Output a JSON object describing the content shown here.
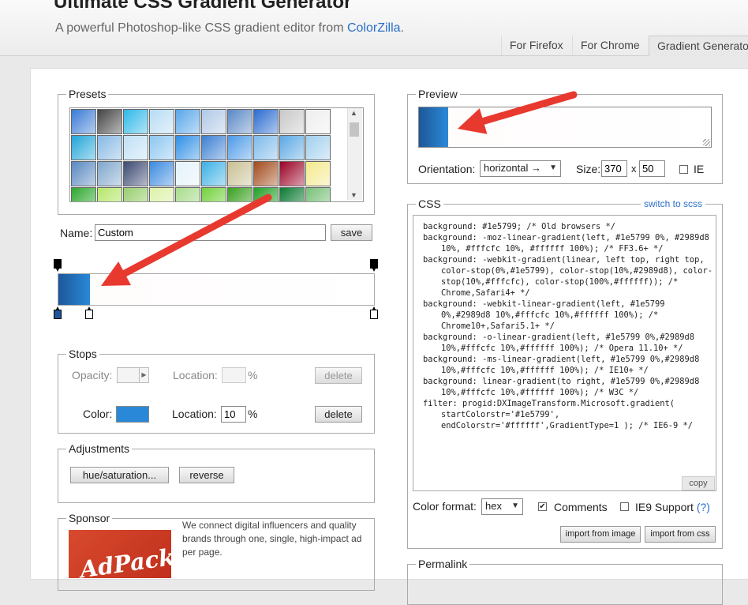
{
  "header": {
    "title": "Ultimate CSS Gradient Generator",
    "subtitle_prefix": "A powerful Photoshop-like CSS gradient editor from ",
    "subtitle_link": "ColorZilla",
    "subtitle_suffix": ".",
    "tabs": [
      "For Firefox",
      "For Chrome",
      "Gradient Generator"
    ]
  },
  "presets": {
    "legend": "Presets",
    "swatches": [
      [
        "#3a7bd5",
        "#444444",
        "#2fb8e8",
        "#b6dcf3",
        "#58a6ea",
        "#b0c8e6",
        "#5a88c6",
        "#2a6bd0",
        "#c8c8c8",
        "#eeeeee"
      ],
      [
        "#22a5d8",
        "#86b8e4",
        "#bfe0f5",
        "#8cc6ef",
        "#2e8fe6",
        "#3b7fd2",
        "#4d9ae8",
        "#7ebaea",
        "#5aa8e4",
        "#a0cfee"
      ],
      [
        "#5888c0",
        "#7fa6cc",
        "#3c4a72",
        "#3b8ae0",
        "#e4f2fb",
        "#3cb0e4",
        "#c8c092",
        "#a24a1a",
        "#9a0024",
        "#f4e98c"
      ],
      [
        "#2ea82e",
        "#b6e66a",
        "#98ce6e",
        "#dcf2a8",
        "#a8dc8c",
        "#72d23c",
        "#3aa020",
        "#22a028",
        "#0a7a32",
        "#78c078"
      ]
    ]
  },
  "name_field": {
    "label": "Name:",
    "value": "Custom",
    "save_label": "save"
  },
  "gradient": {
    "start_color": "#1e5799",
    "stop_2_color": "#2989d8",
    "stop_3_color": "#fffcfc",
    "end_color": "#ffffff"
  },
  "stops": {
    "legend": "Stops",
    "opacity_label": "Opacity:",
    "location_label": "Location:",
    "percent": "%",
    "delete_label": "delete",
    "color_label": "Color:",
    "color_value": "#2989d8",
    "color_location": "10"
  },
  "adjustments": {
    "legend": "Adjustments",
    "hue_label": "hue/saturation...",
    "reverse_label": "reverse"
  },
  "sponsor": {
    "legend": "Sponsor",
    "text": "We connect digital influencers and quality brands through one, single, high-impact ad per page.",
    "logo_text": "AdPacks"
  },
  "preview": {
    "legend": "Preview",
    "orientation_label": "Orientation:",
    "orientation_value": "horizontal →",
    "size_label": "Size:",
    "width": "370",
    "x_label": "x",
    "height": "50",
    "ie_label": "IE"
  },
  "css": {
    "legend": "CSS",
    "switch_label": "switch to scss",
    "lines": [
      "background: #1e5799; /* Old browsers */",
      "background: -moz-linear-gradient(left, #1e5799 0%, #2989d8 10%, #fffcfc 10%, #ffffff 100%); /* FF3.6+ */",
      "background: -webkit-gradient(linear, left top, right top, color-stop(0%,#1e5799), color-stop(10%,#2989d8), color-stop(10%,#fffcfc), color-stop(100%,#ffffff)); /* Chrome,Safari4+ */",
      "background: -webkit-linear-gradient(left, #1e5799 0%,#2989d8 10%,#fffcfc 10%,#ffffff 100%); /* Chrome10+,Safari5.1+ */",
      "background: -o-linear-gradient(left, #1e5799 0%,#2989d8 10%,#fffcfc 10%,#ffffff 100%); /* Opera 11.10+ */",
      "background: -ms-linear-gradient(left, #1e5799 0%,#2989d8 10%,#fffcfc 10%,#ffffff 100%); /* IE10+ */",
      "background: linear-gradient(to right, #1e5799 0%,#2989d8 10%,#fffcfc 10%,#ffffff 100%); /* W3C */",
      "filter: progid:DXImageTransform.Microsoft.gradient( startColorstr='#1e5799', endColorstr='#ffffff',GradientType=1 ); /* IE6-9 */"
    ],
    "copy_label": "copy",
    "format_label": "Color format:",
    "format_value": "hex",
    "comments_label": "Comments",
    "ie9_label": "IE9 Support",
    "ie9_help": "(?)",
    "import_image_label": "import from image",
    "import_css_label": "import from css"
  },
  "permalink": {
    "legend": "Permalink"
  },
  "annotation_color": "#e8392f"
}
